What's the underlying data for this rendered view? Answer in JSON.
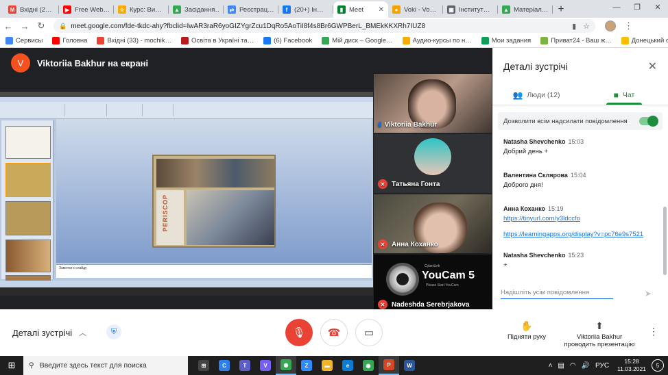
{
  "browser": {
    "tabs": [
      {
        "label": "Вхідні (2…",
        "fav": "M",
        "color": "#ea4335"
      },
      {
        "label": "Free Web…",
        "fav": "▶",
        "color": "#ff0000"
      },
      {
        "label": "Курс: Ви…",
        "fav": "☆",
        "color": "#f9ab00"
      },
      {
        "label": "Засідання…",
        "fav": "▲",
        "color": "#34a853"
      },
      {
        "label": "Реєстрац…",
        "fav": "⇄",
        "color": "#4285f4"
      },
      {
        "label": "(20+) Ін…",
        "fav": "f",
        "color": "#1877f2"
      },
      {
        "label": "Meet",
        "fav": "▮",
        "color": "#00832d",
        "active": true
      },
      {
        "label": "Voki - Vo…",
        "fav": "●",
        "color": "#f4a300"
      },
      {
        "label": "Інститут…",
        "fav": "▦",
        "color": "#5f6368"
      },
      {
        "label": "Матеріал…",
        "fav": "▲",
        "color": "#34a853"
      }
    ],
    "new_tab": "+",
    "url": "meet.google.com/fde-tkdc-ahy?fbclid=IwAR3raR6yoGIZYgrZcu1DqRo5AoTiI8f4s8Br6GWPBerL_BMEkKKXRh7IUZ8",
    "bookmarks": [
      {
        "label": "Сервисы",
        "color": "#4285f4"
      },
      {
        "label": "Головна",
        "color": "#ff0000"
      },
      {
        "label": "Вхідні (33) - mochik…",
        "color": "#ea4335"
      },
      {
        "label": "Освіта в Україні та…",
        "color": "#b71c1c"
      },
      {
        "label": "(6) Facebook",
        "color": "#1877f2"
      },
      {
        "label": "Мій диск – Google…",
        "color": "#34a853"
      },
      {
        "label": "Аудио-курсы по н…",
        "color": "#f9ab00"
      },
      {
        "label": "Мои задания",
        "color": "#0f9d58"
      },
      {
        "label": "Приват24 - Ваш ж…",
        "color": "#7cb342"
      },
      {
        "label": "Донецький обласн…",
        "color": "#fbbc04"
      }
    ]
  },
  "meet": {
    "presenter_initial": "V",
    "presenter_label": "Viktoriia Bakhur на екрані",
    "slide": {
      "photo_text": "PERISCOP",
      "notes": "Заметки к слайду"
    },
    "participants": [
      {
        "name": "Viktoriia Bakhur",
        "muted": false
      },
      {
        "name": "Татьяна Гонта",
        "muted": true
      },
      {
        "name": "Анна Коханко",
        "muted": true
      },
      {
        "name": "Nadeshda Serebrjakova",
        "muted": true
      }
    ],
    "youcam": {
      "brand": "YouCam 5",
      "sub": "CyberLink",
      "hint": "Please Start YouCam"
    }
  },
  "panel": {
    "title": "Деталі зустрічі",
    "tab_people": "Люди (12)",
    "tab_chat": "Чат",
    "allow_label": "Дозволити всім надсилати повідомлення",
    "messages": [
      {
        "author": "Natasha Shevchenko",
        "time": "15:03",
        "text": "Добрий день +"
      },
      {
        "author": "Валентина Склярова",
        "time": "15:04",
        "text": "Доброго дня!"
      },
      {
        "author": "Анна Коханко",
        "time": "15:19",
        "link1": "https://tinyurl.com/y3ldccfo",
        "link2": "https://learningapps.org/display?v=pc76e9s7521"
      },
      {
        "author": "Natasha Shevchenko",
        "time": "15:23",
        "text": "+"
      }
    ],
    "composer_placeholder": "Надішліть усім повідомлення"
  },
  "controls": {
    "details_label": "Деталі зустрічі",
    "raise_hand": "Підняти руку",
    "presenting_line1": "Viktoriia Bakhur",
    "presenting_line2": "проводить презентацію"
  },
  "taskbar": {
    "search_placeholder": "Введите здесь текст для поиска",
    "lang": "РУС",
    "time": "15:28",
    "date": "11.03.2021",
    "notifications": "5",
    "apps": [
      {
        "glyph": "⊞",
        "color": "#444"
      },
      {
        "glyph": "C",
        "color": "#2f80ed"
      },
      {
        "glyph": "T",
        "color": "#5b5fc7"
      },
      {
        "glyph": "V",
        "color": "#7360f2"
      },
      {
        "glyph": "◉",
        "color": "#34a853",
        "active": true
      },
      {
        "glyph": "Z",
        "color": "#2d8cff"
      },
      {
        "glyph": "▬",
        "color": "#f0b429"
      },
      {
        "glyph": "e",
        "color": "#0a7cd6"
      },
      {
        "glyph": "◉",
        "color": "#34a853"
      },
      {
        "glyph": "P",
        "color": "#d24726",
        "active": true
      },
      {
        "glyph": "W",
        "color": "#2b579a"
      }
    ]
  }
}
